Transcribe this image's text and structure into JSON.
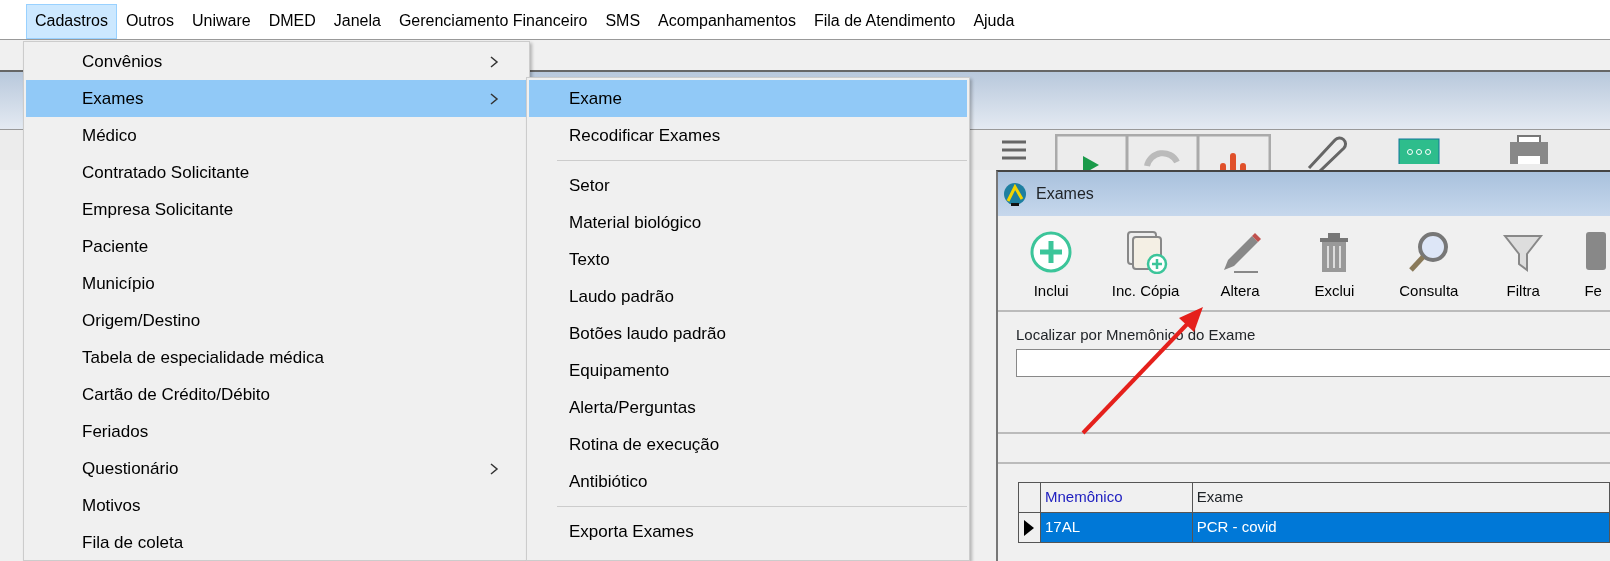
{
  "menubar": [
    {
      "label": "Cadastros",
      "selected": true
    },
    {
      "label": "Outros",
      "selected": false
    },
    {
      "label": "Uniware",
      "selected": false
    },
    {
      "label": "DMED",
      "selected": false
    },
    {
      "label": "Janela",
      "selected": false
    },
    {
      "label": "Gerenciamento Financeiro",
      "selected": false
    },
    {
      "label": "SMS",
      "selected": false
    },
    {
      "label": "Acompanhamentos",
      "selected": false
    },
    {
      "label": "Fila de Atendimento",
      "selected": false
    },
    {
      "label": "Ajuda",
      "selected": false
    }
  ],
  "menu": {
    "items": [
      {
        "label": "Convênios",
        "selected": false,
        "submenu": true
      },
      {
        "label": "Exames",
        "selected": true,
        "submenu": true
      },
      {
        "label": "Médico",
        "selected": false,
        "submenu": false
      },
      {
        "label": "Contratado Solicitante",
        "selected": false,
        "submenu": false
      },
      {
        "label": "Empresa Solicitante",
        "selected": false,
        "submenu": false
      },
      {
        "label": "Paciente",
        "selected": false,
        "submenu": false
      },
      {
        "label": "Município",
        "selected": false,
        "submenu": false
      },
      {
        "label": "Origem/Destino",
        "selected": false,
        "submenu": false
      },
      {
        "label": "Tabela de especialidade médica",
        "selected": false,
        "submenu": false
      },
      {
        "label": "Cartão de Crédito/Débito",
        "selected": false,
        "submenu": false
      },
      {
        "label": "Feriados",
        "selected": false,
        "submenu": false
      },
      {
        "label": "Questionário",
        "selected": false,
        "submenu": true
      },
      {
        "label": "Motivos",
        "selected": false,
        "submenu": false
      },
      {
        "label": "Fila de coleta",
        "selected": false,
        "submenu": false
      }
    ]
  },
  "submenu": {
    "items": [
      {
        "kind": "item",
        "label": "Exame",
        "selected": true
      },
      {
        "kind": "item",
        "label": "Recodificar Exames",
        "selected": false
      },
      {
        "kind": "separator"
      },
      {
        "kind": "item",
        "label": "Setor",
        "selected": false
      },
      {
        "kind": "item",
        "label": "Material biológico",
        "selected": false
      },
      {
        "kind": "item",
        "label": "Texto",
        "selected": false
      },
      {
        "kind": "item",
        "label": "Laudo padrão",
        "selected": false
      },
      {
        "kind": "item",
        "label": "Botões laudo padrão",
        "selected": false
      },
      {
        "kind": "item",
        "label": "Equipamento",
        "selected": false
      },
      {
        "kind": "item",
        "label": "Alerta/Perguntas",
        "selected": false
      },
      {
        "kind": "item",
        "label": "Rotina de execução",
        "selected": false
      },
      {
        "kind": "item",
        "label": "Antibiótico",
        "selected": false
      },
      {
        "kind": "separator"
      },
      {
        "kind": "item",
        "label": "Exporta Exames",
        "selected": false
      }
    ]
  },
  "child_window": {
    "title": "Exames",
    "toolbar": [
      {
        "label": "Inclui",
        "kind": "plus"
      },
      {
        "label": "Inc. Cópia",
        "kind": "copy"
      },
      {
        "label": "Altera",
        "kind": "pencil"
      },
      {
        "label": "Exclui",
        "kind": "trash"
      },
      {
        "label": "Consulta",
        "kind": "search"
      },
      {
        "label": "Filtra",
        "kind": "funnel"
      },
      {
        "label": "Fe",
        "kind": "door"
      }
    ],
    "search": {
      "label": "Localizar por Mnemônico do Exame"
    },
    "grid": {
      "columns": [
        {
          "label": "Mnemônico",
          "sorted": true
        },
        {
          "label": "Exame",
          "sorted": false
        }
      ],
      "rows": [
        {
          "cells": [
            "17AL",
            "PCR - covid"
          ],
          "selected": true
        }
      ]
    }
  }
}
